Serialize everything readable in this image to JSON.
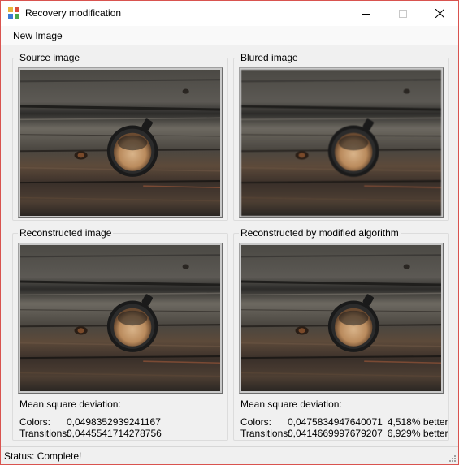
{
  "window": {
    "title": "Recovery modification"
  },
  "menu": {
    "items": [
      "New Image"
    ]
  },
  "panels": {
    "source": {
      "label": "Source image"
    },
    "blured": {
      "label": "Blured image"
    },
    "reconstructed": {
      "label": "Reconstructed image",
      "msd_heading": "Mean square deviation:",
      "colors_label": "Colors:",
      "colors_value": "0,0498352939241167",
      "transitions_label": "Transitions:",
      "transitions_value": "0,0445541714278756"
    },
    "modified": {
      "label": "Reconstructed by modified algorithm",
      "msd_heading": "Mean square deviation:",
      "colors_label": "Colors:",
      "colors_value": "0,0475834947640071",
      "colors_better": "4,518% better",
      "transitions_label": "Transitions:",
      "transitions_value": "0,0414669997679207",
      "transitions_better": "6,929% better"
    }
  },
  "status": {
    "text": "Status: Complete!"
  },
  "colors": {
    "window_border": "#d9534f",
    "wood_dark": "#3a3a38",
    "wood_light": "#6b6761",
    "coffee": "#c9a27a"
  }
}
